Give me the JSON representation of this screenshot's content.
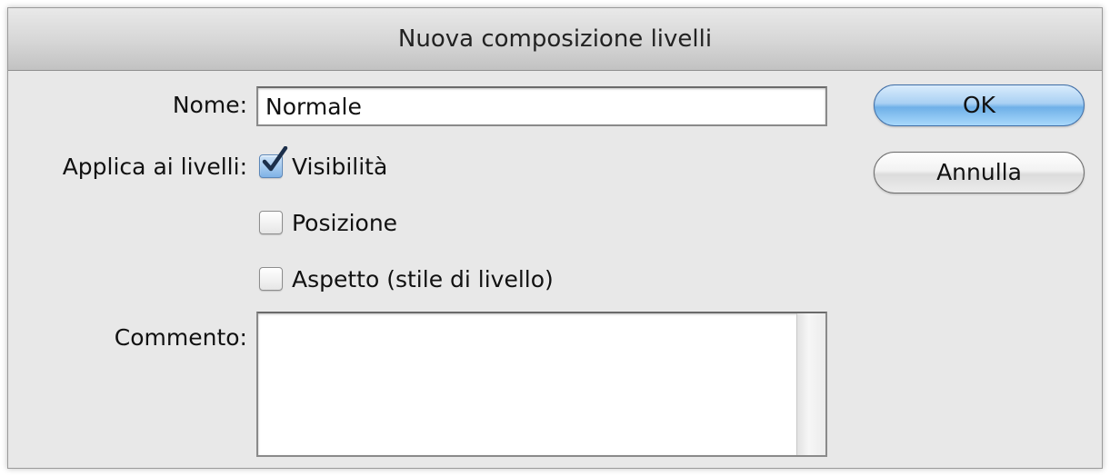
{
  "dialog": {
    "title": "Nuova composizione livelli"
  },
  "form": {
    "name_label": "Nome:",
    "name_value": "Normale",
    "apply_label": "Applica ai livelli:",
    "options": [
      {
        "label": "Visibilità",
        "checked": true
      },
      {
        "label": "Posizione",
        "checked": false
      },
      {
        "label": "Aspetto (stile di livello)",
        "checked": false
      }
    ],
    "comment_label": "Commento:",
    "comment_value": ""
  },
  "buttons": {
    "ok_label": "OK",
    "cancel_label": "Annulla"
  },
  "colors": {
    "dialog_bg": "#e8e8e8",
    "default_button": "#8cc2f0",
    "checkbox_checked": "#7fb2e6"
  }
}
